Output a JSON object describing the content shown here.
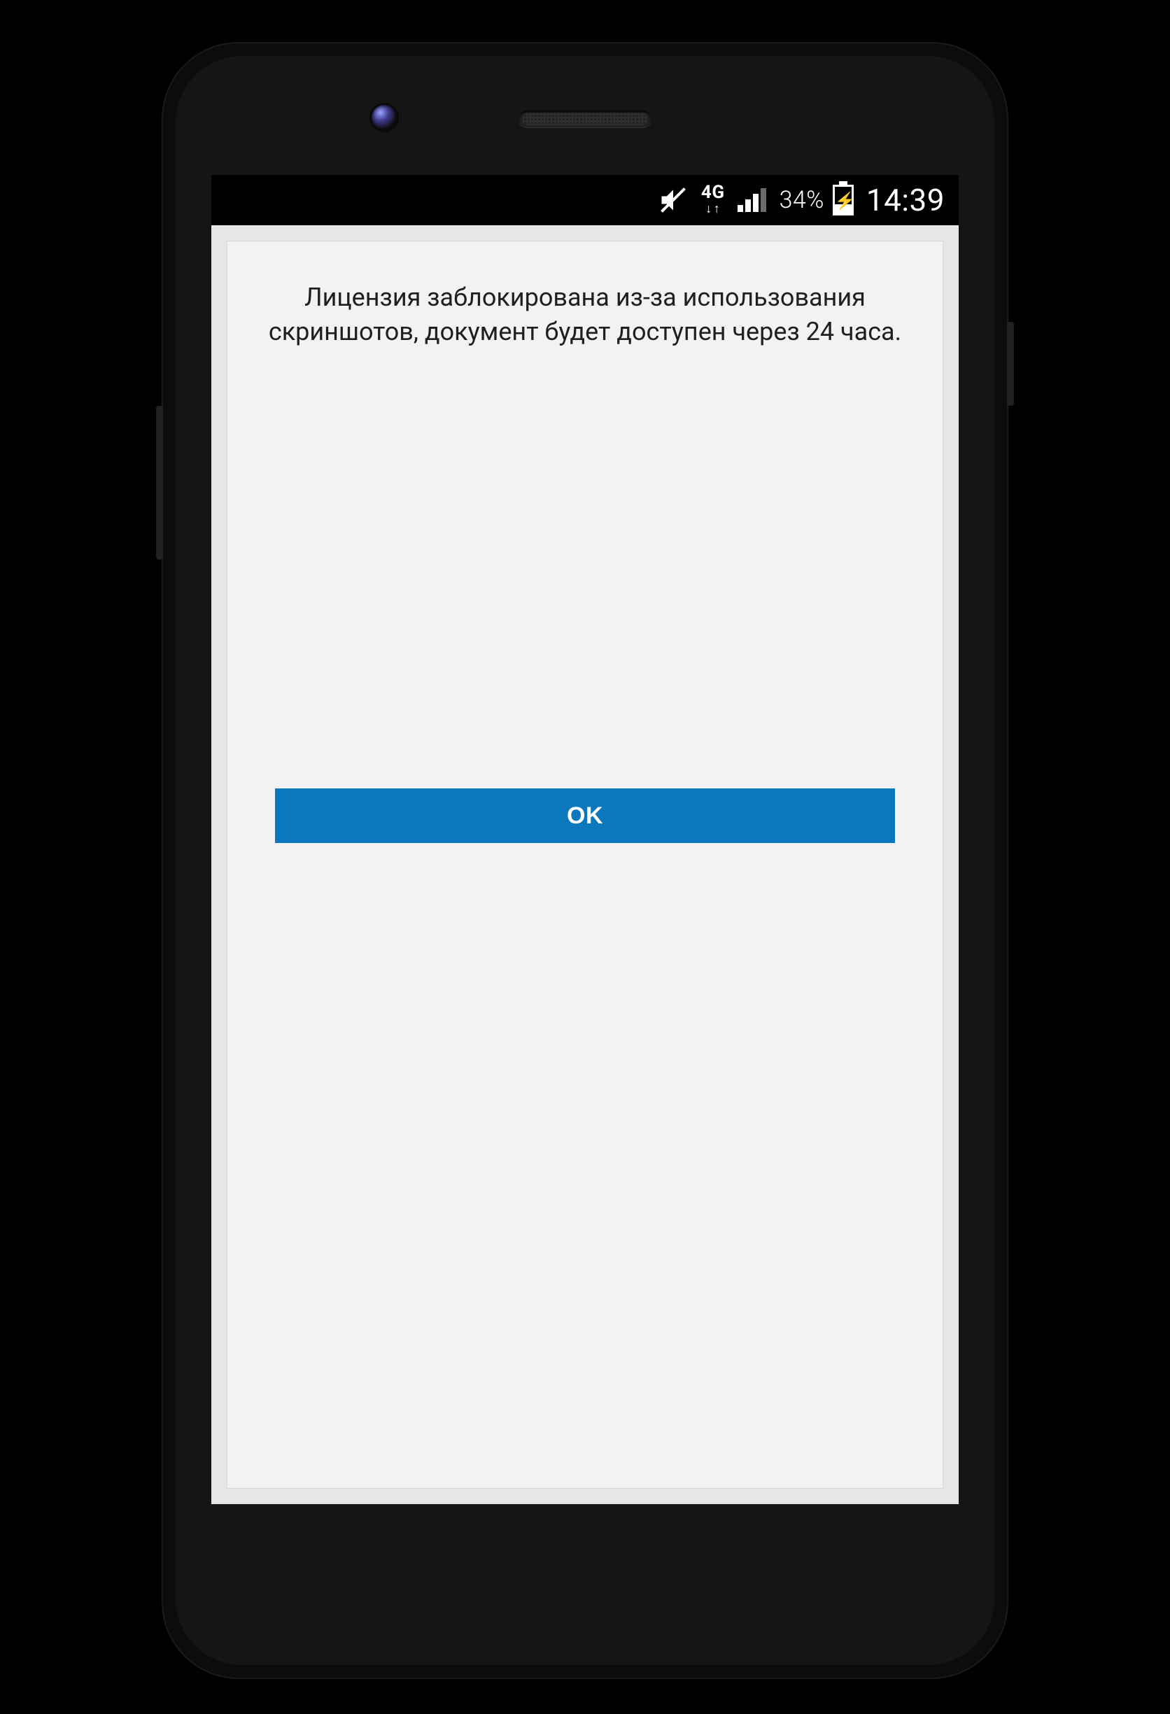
{
  "statusbar": {
    "network_label": "4G",
    "battery_percent_label": "34%",
    "clock": "14:39"
  },
  "dialog": {
    "message": "Лицензия заблокирована из-за использования скриншотов, документ будет доступен через 24 часа.",
    "ok_label": "OK"
  }
}
